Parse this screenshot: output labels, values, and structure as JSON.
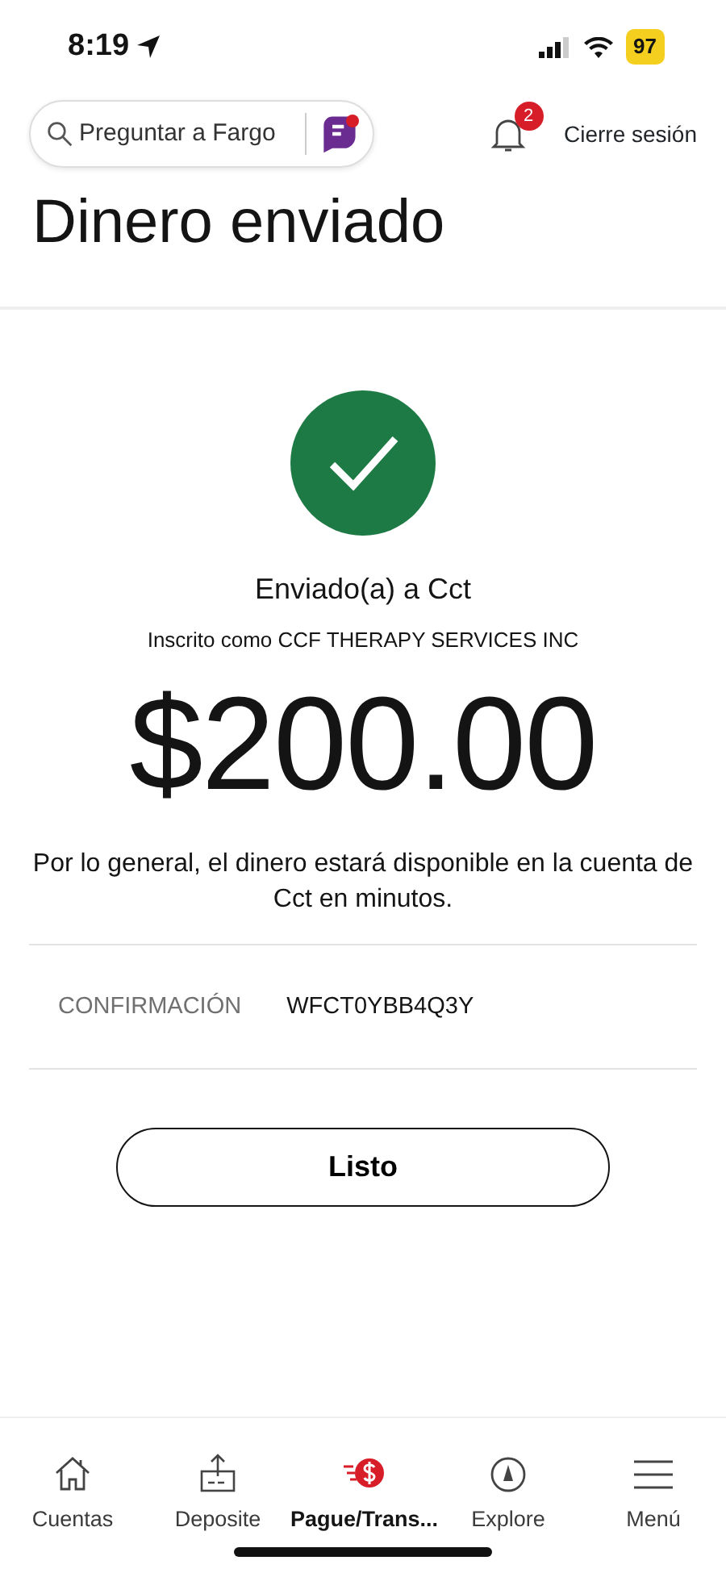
{
  "status_bar": {
    "time": "8:19",
    "battery": "97"
  },
  "header": {
    "search": {
      "placeholder": "Preguntar a Fargo"
    },
    "notifications": {
      "count": "2"
    },
    "signout": "Cierre sesión"
  },
  "title": "Dinero enviado",
  "confirmation": {
    "recipient": "Enviado(a) a Cct",
    "enrolled": "Inscrito como CCF THERAPY SERVICES INC",
    "amount": "$200.00",
    "note": "Por lo general, el dinero estará disponible en la cuenta de Cct en minutos.",
    "label": "CONFIRMACIÓN",
    "code": "WFCT0YBB4Q3Y",
    "button": "Listo"
  },
  "tabs": [
    {
      "kind": "home",
      "label": "Cuentas",
      "selected": false
    },
    {
      "kind": "deposit",
      "label": "Deposite",
      "selected": false
    },
    {
      "kind": "pay",
      "label": "Pague/Trans...",
      "selected": true
    },
    {
      "kind": "explore",
      "label": "Explore",
      "selected": false
    },
    {
      "kind": "menu",
      "label": "Menú",
      "selected": false
    }
  ]
}
